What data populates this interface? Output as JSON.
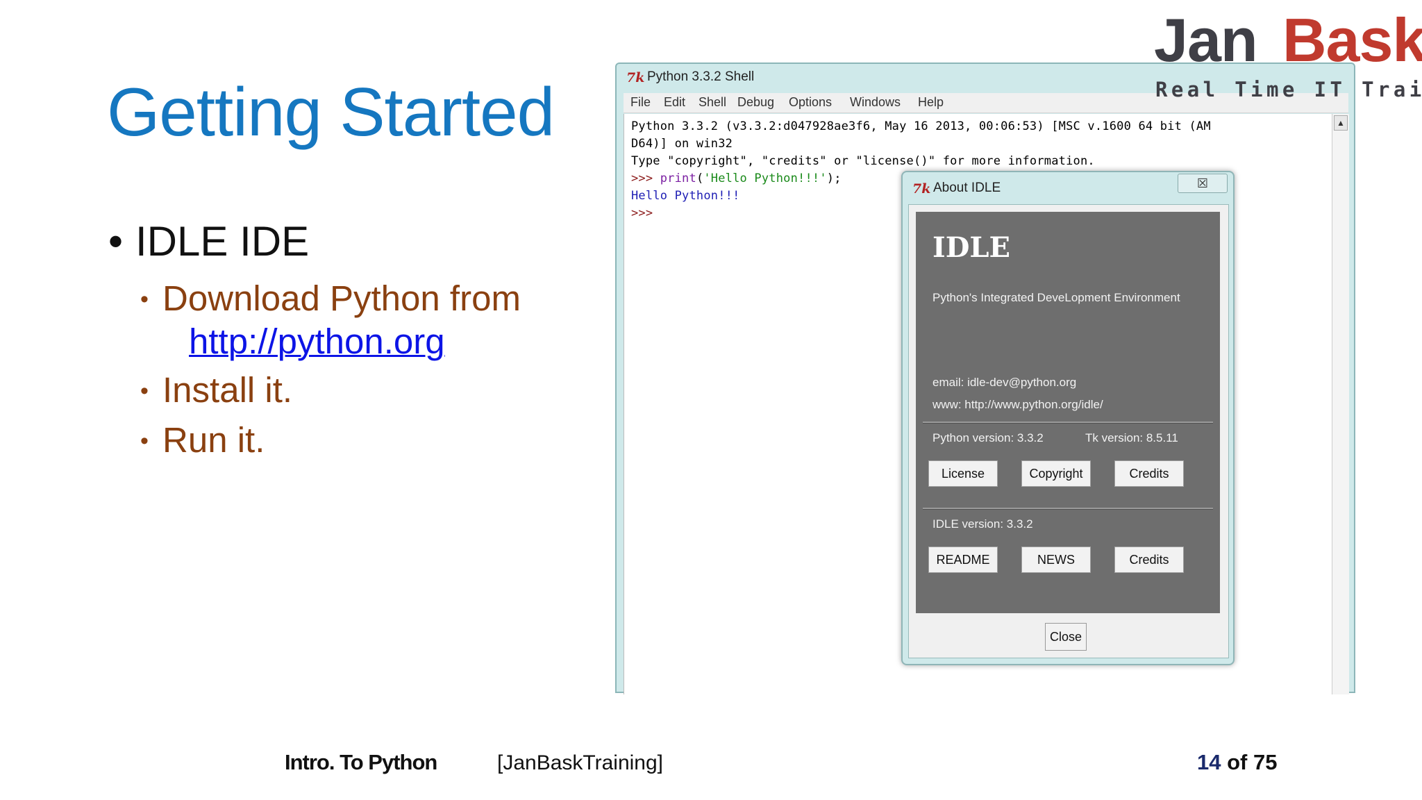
{
  "slide": {
    "title": "Getting Started",
    "bullet": "IDLE IDE",
    "sub_bullets": {
      "download_line1": "Download Python from",
      "download_link": "http://python.org",
      "install": "Install it.",
      "run": "Run it."
    }
  },
  "logo": {
    "jan": "Jan",
    "bask": "Bask",
    "tagline": "Real Time IT Training"
  },
  "shell": {
    "icon": "tk-feather-icon",
    "title": "Python 3.3.2 Shell",
    "menu": [
      "File",
      "Edit",
      "Shell",
      "Debug",
      "Options",
      "Windows",
      "Help"
    ],
    "lines": {
      "l1": "Python 3.3.2 (v3.3.2:d047928ae3f6, May 16 2013, 00:06:53) [MSC v.1600 64 bit (AM",
      "l2": "D64)] on win32",
      "l3": "Type \"copyright\", \"credits\" or \"license()\" for more information.",
      "prompt": ">>> ",
      "print_kw": "print",
      "print_open": "(",
      "print_str": "'Hello Python!!!'",
      "print_close": ");",
      "output": "Hello Python!!!",
      "last_prompt": ">>>"
    }
  },
  "about": {
    "title": "About IDLE",
    "close_x": "☒",
    "heading": "IDLE",
    "subtitle": "Python's Integrated DeveLopment Environment",
    "email": "email:  idle-dev@python.org",
    "www": "www:  http://www.python.org/idle/",
    "python_version": "Python version:  3.3.2",
    "tk_version": "Tk version:  8.5.11",
    "buttons_row1": [
      "License",
      "Copyright",
      "Credits"
    ],
    "idle_version": "IDLE version:   3.3.2",
    "buttons_row2": [
      "README",
      "NEWS",
      "Credits"
    ],
    "close": "Close"
  },
  "footer": {
    "left": "Intro. To Python",
    "center": "[JanBaskTraining]",
    "page_current": "14",
    "page_rest": " of 75"
  },
  "colors": {
    "title": "#1577c0",
    "subbullet": "#8a4010",
    "link": "#0c14e6",
    "brand_dark": "#3f3f46",
    "brand_red": "#c03a2e"
  }
}
